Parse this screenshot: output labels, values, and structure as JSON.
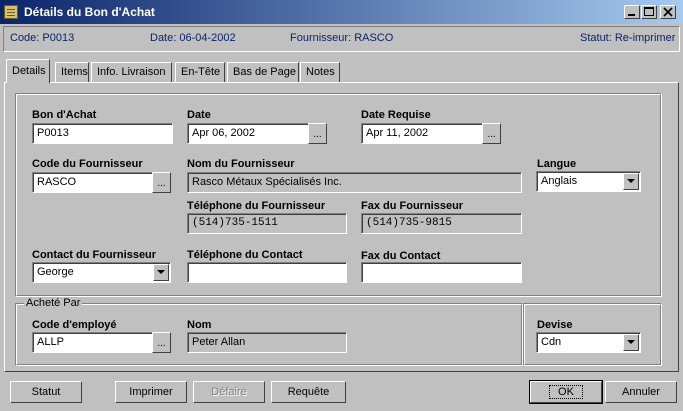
{
  "window": {
    "title": "Détails du Bon d'Achat"
  },
  "infobar": {
    "code": "Code: P0013",
    "date": "Date: 06-04-2002",
    "supplier": "Fournisseur: RASCO",
    "status": "Statut: Re-imprimer"
  },
  "tabs": [
    {
      "label": "Details",
      "active": true
    },
    {
      "label": "Items"
    },
    {
      "label": "Info. Livraison"
    },
    {
      "label": "En-Tête"
    },
    {
      "label": "Bas de Page"
    },
    {
      "label": "Notes"
    }
  ],
  "form": {
    "po_label": "Bon d'Achat",
    "po_value": "P0013",
    "date_label": "Date",
    "date_value": "Apr 06, 2002",
    "req_date_label": "Date Requise",
    "req_date_value": "Apr 11, 2002",
    "supplier_code_label": "Code du Fournisseur",
    "supplier_code_value": "RASCO",
    "supplier_name_label": "Nom du Fournisseur",
    "supplier_name_value": "Rasco Métaux Spécialisés Inc.",
    "language_label": "Langue",
    "language_value": "Anglais",
    "supplier_phone_label": "Téléphone du Fournisseur",
    "supplier_phone_value": "(514)735-1511",
    "supplier_fax_label": "Fax du Fournisseur",
    "supplier_fax_value": "(514)735-9815",
    "contact_label": "Contact du Fournisseur",
    "contact_value": "George",
    "contact_phone_label": "Téléphone du Contact",
    "contact_phone_value": "",
    "contact_fax_label": "Fax du Contact",
    "contact_fax_value": "",
    "dots": "..."
  },
  "purchased_by": {
    "legend": "Acheté Par",
    "employee_code_label": "Code d'employé",
    "employee_code_value": "ALLP",
    "name_label": "Nom",
    "name_value": "Peter Allan",
    "currency_label": "Devise",
    "currency_value": "Cdn"
  },
  "buttons": {
    "status": "Statut",
    "print": "Imprimer",
    "undo": "Défaire",
    "query": "Requête",
    "ok": "OK",
    "cancel": "Annuler"
  }
}
